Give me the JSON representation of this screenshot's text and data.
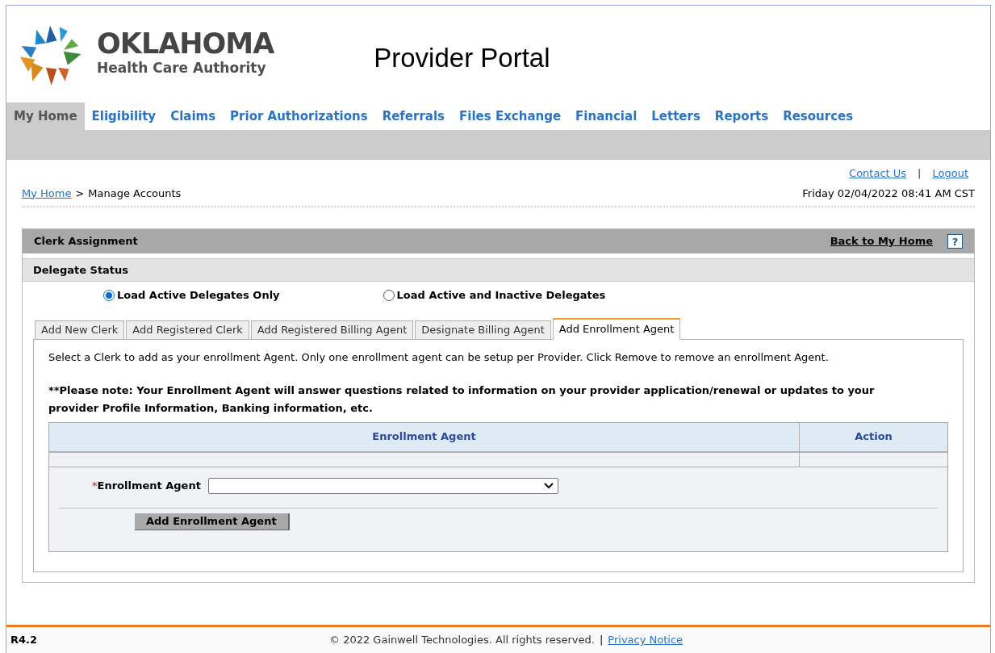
{
  "header": {
    "logo_title": "OKLAHOMA",
    "logo_subtitle": "Health Care Authority",
    "portal_title": "Provider Portal"
  },
  "nav": [
    {
      "label": "My Home",
      "selected": true
    },
    {
      "label": "Eligibility",
      "selected": false
    },
    {
      "label": "Claims",
      "selected": false
    },
    {
      "label": "Prior Authorizations",
      "selected": false
    },
    {
      "label": "Referrals",
      "selected": false
    },
    {
      "label": "Files Exchange",
      "selected": false
    },
    {
      "label": "Financial",
      "selected": false
    },
    {
      "label": "Letters",
      "selected": false
    },
    {
      "label": "Reports",
      "selected": false
    },
    {
      "label": "Resources",
      "selected": false
    }
  ],
  "top_links": [
    "Contact Us",
    "Logout"
  ],
  "top_links_separator": "|",
  "breadcrumb": {
    "link": "My Home",
    "separator": ">",
    "current": "Manage Accounts"
  },
  "datetime": "Friday 02/04/2022 08:41 AM CST",
  "panel": {
    "title": "Clerk Assignment",
    "back_link": "Back to My Home",
    "help": "?"
  },
  "delegate_status": {
    "title": "Delegate Status",
    "options": [
      {
        "label": "Load Active Delegates Only",
        "selected": true
      },
      {
        "label": "Load Active and Inactive Delegates",
        "selected": false
      }
    ]
  },
  "tabs": [
    {
      "label": "Add New Clerk",
      "selected": false
    },
    {
      "label": "Add Registered Clerk",
      "selected": false
    },
    {
      "label": "Add Registered Billing Agent",
      "selected": false
    },
    {
      "label": "Designate Billing Agent",
      "selected": false
    },
    {
      "label": "Add Enrollment Agent",
      "selected": true
    }
  ],
  "instructions": "Select a Clerk to add as your enrollment Agent. Only one enrollment agent can be setup per Provider. Click Remove to remove an enrollment Agent.",
  "note": "**Please note: Your Enrollment Agent will answer questions related to information on your provider application/renewal or updates to your provider Profile Information, Banking information, etc.",
  "table": {
    "columns": [
      "Enrollment Agent",
      "Action"
    ]
  },
  "form": {
    "required_mark": "*",
    "label": "Enrollment Agent",
    "button": "Add Enrollment Agent"
  },
  "footer": {
    "version": "R4.2",
    "copyright": "© 2022 Gainwell Technologies. All rights reserved.",
    "separator": "|",
    "link": "Privacy Notice"
  }
}
